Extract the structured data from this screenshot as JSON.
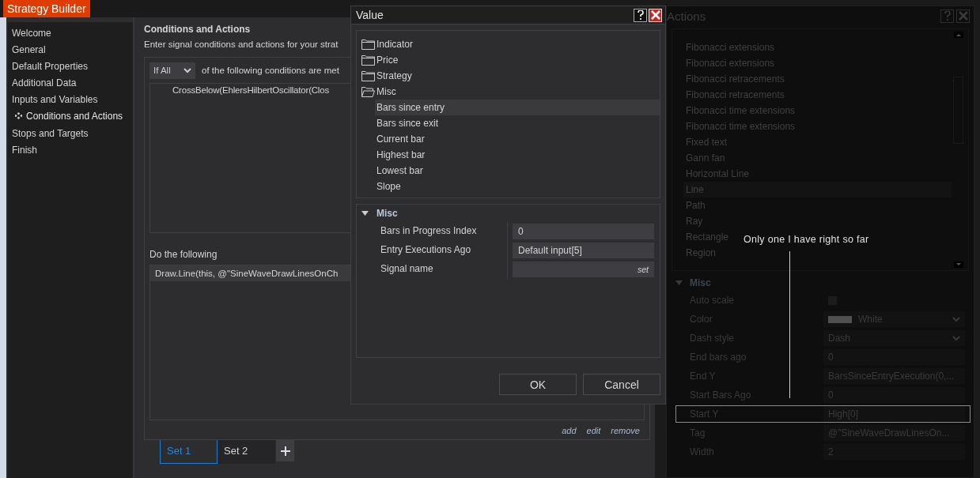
{
  "app_tab": {
    "label": "Strategy Builder"
  },
  "sidebar": {
    "items": [
      {
        "label": "Welcome",
        "selected": false
      },
      {
        "label": "General",
        "selected": false
      },
      {
        "label": "Default Properties",
        "selected": false
      },
      {
        "label": "Additional Data",
        "selected": false
      },
      {
        "label": "Inputs and Variables",
        "selected": false
      },
      {
        "label": "Conditions and Actions",
        "selected": true
      },
      {
        "label": "Stops and Targets",
        "selected": false
      },
      {
        "label": "Finish",
        "selected": false
      }
    ]
  },
  "content": {
    "title": "Conditions and Actions",
    "description": "Enter signal conditions and actions for your strat",
    "condition_mode": "If All",
    "condition_text": "of the following conditions are met",
    "conditions": [
      "CrossBelow(EhlersHilbertOscillator(Clos"
    ],
    "actions_label": "Do the following",
    "actions": [
      {
        "text": "Draw.Line(this, @\"SineWaveDrawLinesOnCh",
        "selected": true
      }
    ],
    "links": [
      "add",
      "edit",
      "remove"
    ],
    "sets": [
      {
        "label": "Set 1",
        "selected": true
      },
      {
        "label": "Set 2",
        "selected": false
      }
    ]
  },
  "value_dialog": {
    "title": "Value",
    "tree": [
      {
        "label": "Indicator",
        "expanded": false
      },
      {
        "label": "Price",
        "expanded": false
      },
      {
        "label": "Strategy",
        "expanded": false
      },
      {
        "label": "Misc",
        "expanded": true,
        "children": [
          {
            "label": "Bars since entry",
            "selected": true
          },
          {
            "label": "Bars since exit",
            "selected": false
          },
          {
            "label": "Current bar",
            "selected": false
          },
          {
            "label": "Highest bar",
            "selected": false
          },
          {
            "label": "Lowest bar",
            "selected": false
          },
          {
            "label": "Slope",
            "selected": false
          }
        ]
      }
    ],
    "properties": {
      "section": "Misc",
      "expanded": true,
      "rows": [
        {
          "kind": "text",
          "label": "Bars in Progress Index",
          "value": "0"
        },
        {
          "kind": "text",
          "label": "Entry Executions Ago",
          "value": "Default input[5]"
        },
        {
          "kind": "action",
          "label": "Signal name",
          "action": "set"
        }
      ]
    },
    "buttons": [
      "OK",
      "Cancel"
    ]
  },
  "actions_window": {
    "title": "Actions",
    "items": [
      {
        "label": "Fibonacci extensions",
        "selected": false
      },
      {
        "label": "Fibonacci extensions",
        "selected": false
      },
      {
        "label": "Fibonacci retracements",
        "selected": false
      },
      {
        "label": "Fibonacci retracements",
        "selected": false
      },
      {
        "label": "Fibonacci time extensions",
        "selected": false
      },
      {
        "label": "Fibonacci time extensions",
        "selected": false
      },
      {
        "label": "Fixed text",
        "selected": false
      },
      {
        "label": "Gann fan",
        "selected": false
      },
      {
        "label": "Horizontal Line",
        "selected": false
      },
      {
        "label": "Line",
        "selected": true
      },
      {
        "label": "Path",
        "selected": false
      },
      {
        "label": "Ray",
        "selected": false
      },
      {
        "label": "Rectangle",
        "selected": false
      },
      {
        "label": "Region",
        "selected": false
      }
    ],
    "properties": {
      "section": "Misc",
      "expanded": true,
      "rows": [
        {
          "kind": "checkbox",
          "label": "Auto scale",
          "checked": false,
          "selected": false
        },
        {
          "kind": "color",
          "label": "Color",
          "color": "#505050",
          "value": "White",
          "selected": false
        },
        {
          "kind": "select",
          "label": "Dash style",
          "value": "Dash",
          "selected": false
        },
        {
          "kind": "text",
          "label": "End bars ago",
          "value": "0",
          "selected": false
        },
        {
          "kind": "text",
          "label": "End Y",
          "value": "BarsSinceEntryExecution(0,...",
          "selected": false
        },
        {
          "kind": "text",
          "label": "Start Bars Ago",
          "value": "0",
          "selected": false
        },
        {
          "kind": "text",
          "label": "Start Y",
          "value": "High[0]",
          "selected": true
        },
        {
          "kind": "text",
          "label": "Tag",
          "value": "@\"SineWaveDrawLinesOn...",
          "selected": false
        },
        {
          "kind": "text",
          "label": "Width",
          "value": "2",
          "selected": false
        }
      ]
    }
  },
  "annotation": {
    "text": "Only one I have right so far"
  }
}
